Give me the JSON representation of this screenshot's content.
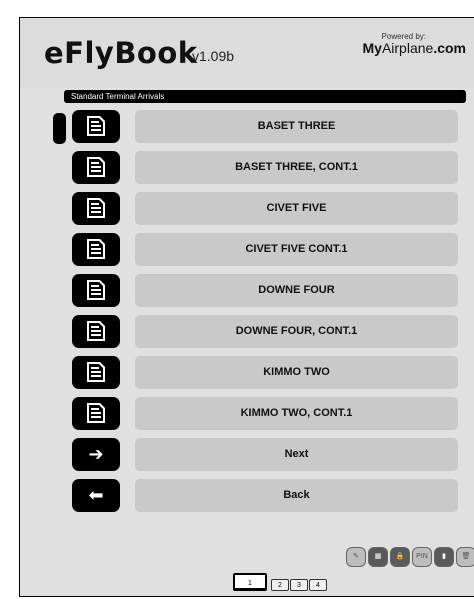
{
  "header": {
    "app_name": "eFlyBook",
    "version": "v1.09b",
    "powered_by": "Powered by:",
    "brand_bold": "My",
    "brand_light": "Airplane",
    "brand_suffix": ".com"
  },
  "section_title": "Standard Terminal Arrivals",
  "procedures": [
    {
      "label": "BASET THREE",
      "selected": true
    },
    {
      "label": "BASET THREE, CONT.1"
    },
    {
      "label": "CIVET FIVE"
    },
    {
      "label": "CIVET FIVE CONT.1"
    },
    {
      "label": "DOWNE FOUR"
    },
    {
      "label": "DOWNE FOUR, CONT.1"
    },
    {
      "label": "KIMMO TWO"
    },
    {
      "label": "KIMMO TWO, CONT.1"
    }
  ],
  "nav": {
    "next_label": "Next",
    "back_label": "Back"
  },
  "toolbar": {
    "pin_label": "PIN"
  },
  "pagination": {
    "pages": [
      "1",
      "2",
      "3",
      "4"
    ],
    "current": "1"
  },
  "colors": {
    "button_fill": "#c9c9c9",
    "icon_button": "#000000",
    "background": "#e0e0e0"
  }
}
